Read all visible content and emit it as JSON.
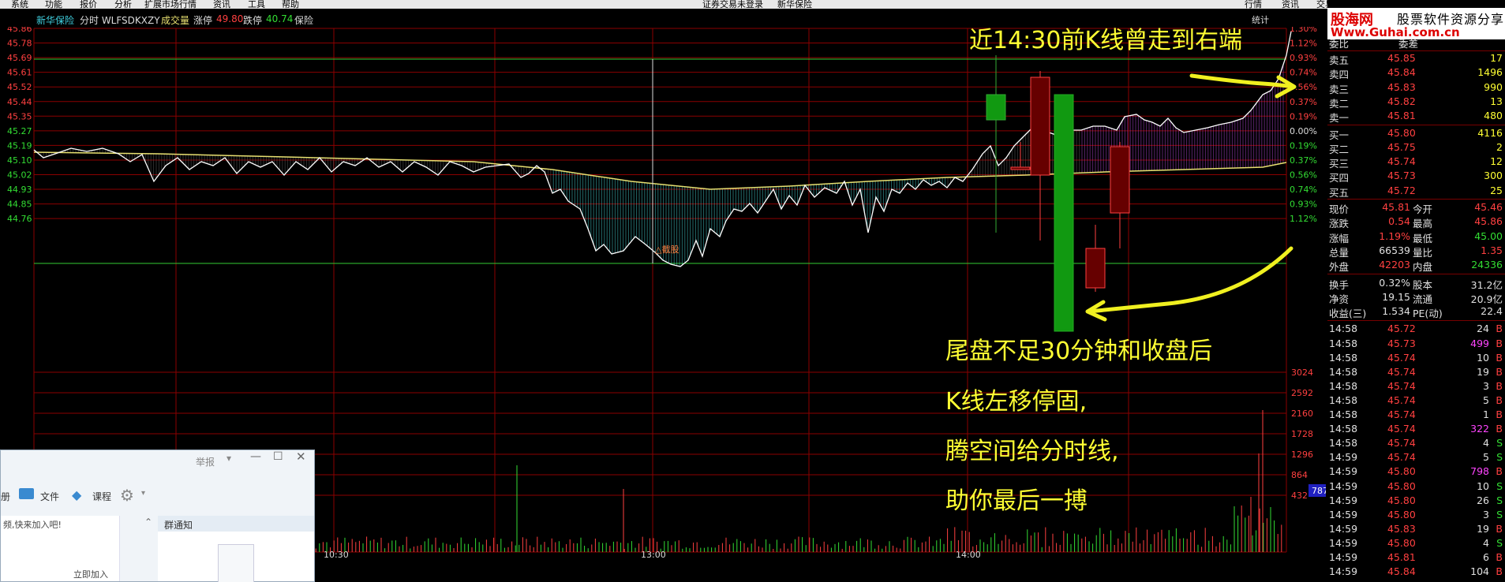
{
  "menubar": {
    "items": [
      "系统",
      "功能",
      "报价",
      "分析",
      "扩展市场行情",
      "资讯",
      "工具",
      "帮助"
    ],
    "center": [
      "证券交易未登录",
      "新华保险"
    ],
    "right": [
      "行情",
      "资讯",
      "交易"
    ]
  },
  "infobar": {
    "stock": "新华保险",
    "mode": "分时 WLFSDKXZY",
    "volume_label": "成交量",
    "limit_up_label": "涨停",
    "limit_up": "49.80",
    "limit_down_label": "跌停",
    "limit_down": "40.74",
    "sector": "保险"
  },
  "price_axis": [
    "45.86",
    "45.78",
    "45.69",
    "45.61",
    "45.52",
    "45.44",
    "45.35",
    "45.27",
    "45.19",
    "45.10",
    "45.02",
    "44.93",
    "44.85",
    "44.76"
  ],
  "pct_axis": [
    "1.30%",
    "1.12%",
    "0.93%",
    "0.74%",
    "0.56%",
    "0.37%",
    "0.19%",
    "0.00%",
    "0.19%",
    "0.37%",
    "0.56%",
    "0.74%",
    "0.93%",
    "1.12%"
  ],
  "vol_axis": [
    "3024",
    "2592",
    "2160",
    "1728",
    "1296",
    "864",
    "432"
  ],
  "vol_cursor": "787",
  "time_labels": [
    "10:30",
    "13:00",
    "14:00"
  ],
  "stats_label": "统计",
  "chart_tag": "△截股",
  "annotations": {
    "top": "近14:30前K线曾走到右端",
    "line1": "尾盘不足30分钟和收盘后",
    "line2": "K线左移停固,",
    "line3": "腾空间给分时线,",
    "line4": "助你最后一搏"
  },
  "logo": {
    "brand": "股海网",
    "slogan": "股票软件资源分享",
    "url": "Www.Guhai.com.cn"
  },
  "orderbook": {
    "header": [
      "委比",
      "委差"
    ],
    "asks": [
      {
        "label": "卖五",
        "price": "45.85",
        "vol": "17"
      },
      {
        "label": "卖四",
        "price": "45.84",
        "vol": "1496"
      },
      {
        "label": "卖三",
        "price": "45.83",
        "vol": "990"
      },
      {
        "label": "卖二",
        "price": "45.82",
        "vol": "13"
      },
      {
        "label": "卖一",
        "price": "45.81",
        "vol": "480"
      }
    ],
    "bids": [
      {
        "label": "买一",
        "price": "45.80",
        "vol": "4116"
      },
      {
        "label": "买二",
        "price": "45.75",
        "vol": "2"
      },
      {
        "label": "买三",
        "price": "45.74",
        "vol": "12"
      },
      {
        "label": "买四",
        "price": "45.73",
        "vol": "300"
      },
      {
        "label": "买五",
        "price": "45.72",
        "vol": "25"
      }
    ]
  },
  "quote": [
    {
      "l1": "现价",
      "v1": "45.81",
      "l2": "今开",
      "v2": "45.46",
      "c1": "red",
      "c2": "red"
    },
    {
      "l1": "涨跌",
      "v1": "0.54",
      "l2": "最高",
      "v2": "45.86",
      "c1": "red",
      "c2": "red"
    },
    {
      "l1": "涨幅",
      "v1": "1.19%",
      "l2": "最低",
      "v2": "45.00",
      "c1": "red",
      "c2": "grn"
    },
    {
      "l1": "总量",
      "v1": "66539",
      "l2": "量比",
      "v2": "1.35",
      "c1": "wht",
      "c2": "red"
    },
    {
      "l1": "外盘",
      "v1": "42203",
      "l2": "内盘",
      "v2": "24336",
      "c1": "red",
      "c2": "grn"
    },
    {
      "l1": "换手",
      "v1": "0.32%",
      "l2": "股本",
      "v2": "31.2亿",
      "c1": "wht",
      "c2": "wht"
    },
    {
      "l1": "净资",
      "v1": "19.15",
      "l2": "流通",
      "v2": "20.9亿",
      "c1": "wht",
      "c2": "wht"
    },
    {
      "l1": "收益(三)",
      "v1": "1.534",
      "l2": "PE(动)",
      "v2": "22.4",
      "c1": "wht",
      "c2": "wht"
    }
  ],
  "ticks": [
    {
      "t": "14:58",
      "p": "45.72",
      "v": "24",
      "d": "B",
      "pc": "red",
      "vc": "wht"
    },
    {
      "t": "14:58",
      "p": "45.73",
      "v": "499",
      "d": "B",
      "pc": "red",
      "vc": "mag"
    },
    {
      "t": "14:58",
      "p": "45.74",
      "v": "10",
      "d": "B",
      "pc": "red",
      "vc": "wht"
    },
    {
      "t": "14:58",
      "p": "45.74",
      "v": "19",
      "d": "B",
      "pc": "red",
      "vc": "wht"
    },
    {
      "t": "14:58",
      "p": "45.74",
      "v": "3",
      "d": "B",
      "pc": "red",
      "vc": "wht"
    },
    {
      "t": "14:58",
      "p": "45.74",
      "v": "5",
      "d": "B",
      "pc": "red",
      "vc": "wht"
    },
    {
      "t": "14:58",
      "p": "45.74",
      "v": "1",
      "d": "B",
      "pc": "red",
      "vc": "wht"
    },
    {
      "t": "14:58",
      "p": "45.74",
      "v": "322",
      "d": "B",
      "pc": "red",
      "vc": "mag"
    },
    {
      "t": "14:58",
      "p": "45.74",
      "v": "4",
      "d": "S",
      "pc": "red",
      "vc": "wht"
    },
    {
      "t": "14:59",
      "p": "45.74",
      "v": "5",
      "d": "S",
      "pc": "red",
      "vc": "wht"
    },
    {
      "t": "14:59",
      "p": "45.80",
      "v": "798",
      "d": "B",
      "pc": "red",
      "vc": "mag"
    },
    {
      "t": "14:59",
      "p": "45.80",
      "v": "10",
      "d": "S",
      "pc": "red",
      "vc": "wht"
    },
    {
      "t": "14:59",
      "p": "45.80",
      "v": "26",
      "d": "S",
      "pc": "red",
      "vc": "wht"
    },
    {
      "t": "14:59",
      "p": "45.80",
      "v": "3",
      "d": "S",
      "pc": "red",
      "vc": "wht"
    },
    {
      "t": "14:59",
      "p": "45.83",
      "v": "19",
      "d": "B",
      "pc": "red",
      "vc": "wht"
    },
    {
      "t": "14:59",
      "p": "45.80",
      "v": "4",
      "d": "S",
      "pc": "red",
      "vc": "wht"
    },
    {
      "t": "14:59",
      "p": "45.81",
      "v": "6",
      "d": "B",
      "pc": "red",
      "vc": "wht"
    },
    {
      "t": "14:59",
      "p": "45.84",
      "v": "104",
      "d": "B",
      "pc": "red",
      "vc": "wht"
    }
  ],
  "dialog": {
    "title": "举报",
    "toolbar": [
      "册",
      "文件",
      "课程"
    ],
    "promo": "频,快来加入吧!",
    "notice_tab": "群通知",
    "join": "立即加入"
  },
  "colors": {
    "up": "#ff4040",
    "down": "#33dd33",
    "grid": "#8b0000",
    "price_line": "#ffffff",
    "avg_line": "#e8e070",
    "annot": "#ffff33"
  }
}
